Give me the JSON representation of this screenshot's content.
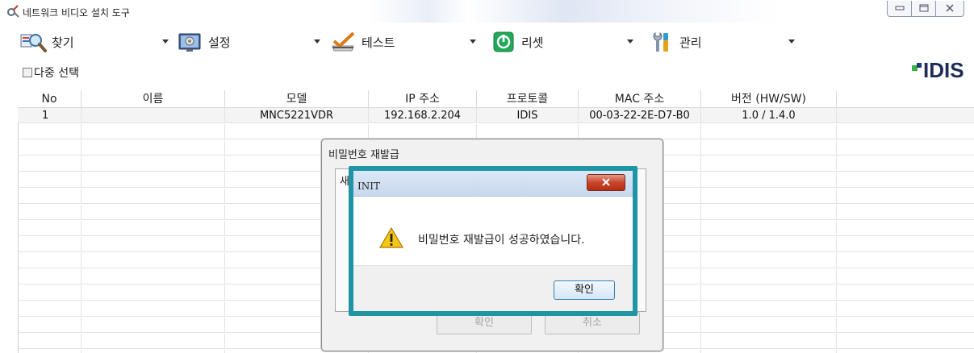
{
  "window": {
    "title": "네트워크 비디오 설치 도구",
    "icons": {
      "app": "tools-icon",
      "minimize": "minimize-icon",
      "maximize": "maximize-icon",
      "close": "close-icon"
    }
  },
  "toolbar": {
    "items": [
      {
        "label": "찾기",
        "icon": "search-icon"
      },
      {
        "label": "설정",
        "icon": "settings-icon"
      },
      {
        "label": "테스트",
        "icon": "test-icon"
      },
      {
        "label": "리셋",
        "icon": "power-reset-icon"
      },
      {
        "label": "관리",
        "icon": "manage-icon"
      }
    ],
    "multi_select_label": "다중 선택",
    "multi_select_checked": false
  },
  "brand": {
    "text": "IDIS",
    "colors": {
      "green": "#35b24a",
      "navy": "#1e2c58"
    }
  },
  "table": {
    "columns": [
      "No",
      "이름",
      "모델",
      "IP 주소",
      "프로토콜",
      "MAC 주소",
      "버전 (HW/SW)"
    ],
    "rows": [
      {
        "no": "1",
        "name": "",
        "model": "MNC5221VDR",
        "ip": "192.168.2.204",
        "protocol": "IDIS",
        "mac": "00-03-22-2E-D7-B0",
        "version": "1.0 / 1.4.0"
      }
    ]
  },
  "password_dialog": {
    "title": "비밀번호 재발급",
    "group_text": "새",
    "ok_label": "확인",
    "cancel_label": "취소"
  },
  "message_box": {
    "title": "INIT",
    "message": "비밀번호 재발급이 성공하였습니다.",
    "ok_label": "확인",
    "icon": "warning-icon",
    "close_icon": "close-icon",
    "highlight_color": "#1f94a5"
  }
}
